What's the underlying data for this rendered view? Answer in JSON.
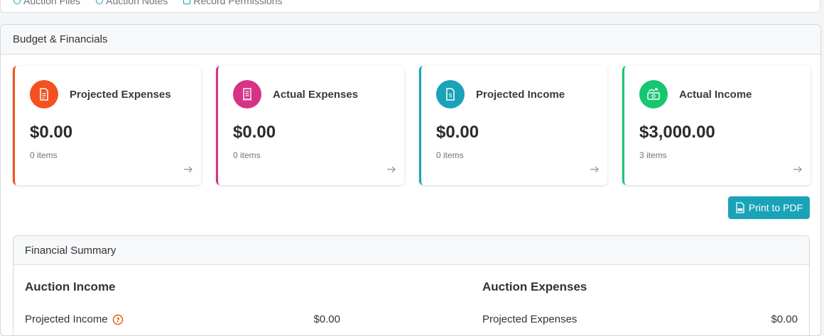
{
  "top_links": [
    {
      "label": "Auction Files"
    },
    {
      "label": "Auction Notes"
    },
    {
      "label": "Record Permissions"
    }
  ],
  "panel": {
    "title": "Budget & Financials"
  },
  "cards": [
    {
      "title": "Projected Expenses",
      "amount": "$0.00",
      "count": "0 items",
      "color": "#f4511e",
      "icon": "document-icon"
    },
    {
      "title": "Actual Expenses",
      "amount": "$0.00",
      "count": "0 items",
      "color": "#d63384",
      "icon": "receipt-icon"
    },
    {
      "title": "Projected Income",
      "amount": "$0.00",
      "count": "0 items",
      "color": "#1aa3b8",
      "icon": "invoice-dollar-icon"
    },
    {
      "title": "Actual Income",
      "amount": "$3,000.00",
      "count": "3 items",
      "color": "#17c671",
      "icon": "money-growth-icon"
    }
  ],
  "actions": {
    "print_label": "Print to PDF"
  },
  "summary": {
    "title": "Financial Summary",
    "income": {
      "heading": "Auction Income",
      "row_label": "Projected Income",
      "row_value": "$0.00"
    },
    "expenses": {
      "heading": "Auction Expenses",
      "row_label": "Projected Expenses",
      "row_value": "$0.00"
    }
  }
}
